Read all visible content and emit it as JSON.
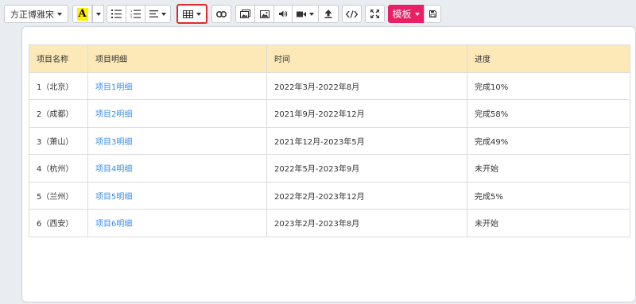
{
  "toolbar": {
    "font_name": "方正博雅宋",
    "highlight_letter": "A",
    "template_label": "模板"
  },
  "table": {
    "headers": [
      "项目名称",
      "项目明细",
      "时间",
      "进度"
    ],
    "rows": [
      [
        "1（北京）",
        "项目1明细",
        "2022年3月-2022年8月",
        "完成10%"
      ],
      [
        "2（成都）",
        "项目2明细",
        "2021年9月-2022年12月",
        "完成58%"
      ],
      [
        "3（萧山）",
        "项目3明细",
        "2021年12月-2023年5月",
        "完成49%"
      ],
      [
        "4（杭州）",
        "项目4明细",
        "2022年5月-2023年9月",
        "未开始"
      ],
      [
        "5（兰州）",
        "项目5明细",
        "2022年2月-2023年12月",
        "完成5%"
      ],
      [
        "6（西安）",
        "项目6明细",
        "2023年2月-2023年8月",
        "未开始"
      ]
    ]
  },
  "colors": {
    "header_bg": "#fde9b7",
    "link": "#3a8ee6",
    "template_button": "#e91e63",
    "highlight": "#ffef00",
    "active_border": "#e02b2b"
  }
}
